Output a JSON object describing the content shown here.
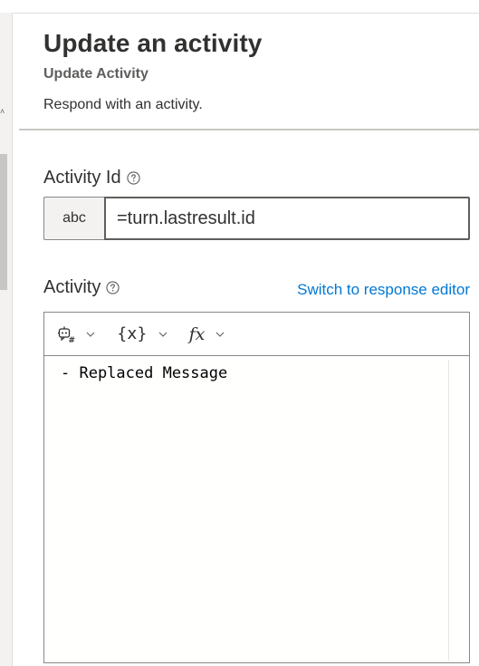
{
  "header": {
    "title": "Update an activity",
    "subtitle": "Update Activity",
    "description": "Respond with an activity."
  },
  "activity_id": {
    "label": "Activity Id",
    "type_badge": "abc",
    "value": "=turn.lastresult.id",
    "help_icon": "question-circle-icon"
  },
  "activity": {
    "label": "Activity",
    "help_icon": "question-circle-icon",
    "switch_link": "Switch to response editor",
    "toolbar": {
      "bot_icon": "bot-template-icon",
      "braces_label": "{x}",
      "fx_label": "fx"
    },
    "code": "- Replaced Message"
  },
  "colors": {
    "link": "#0078d4",
    "text": "#323130",
    "border": "#8a8886"
  }
}
